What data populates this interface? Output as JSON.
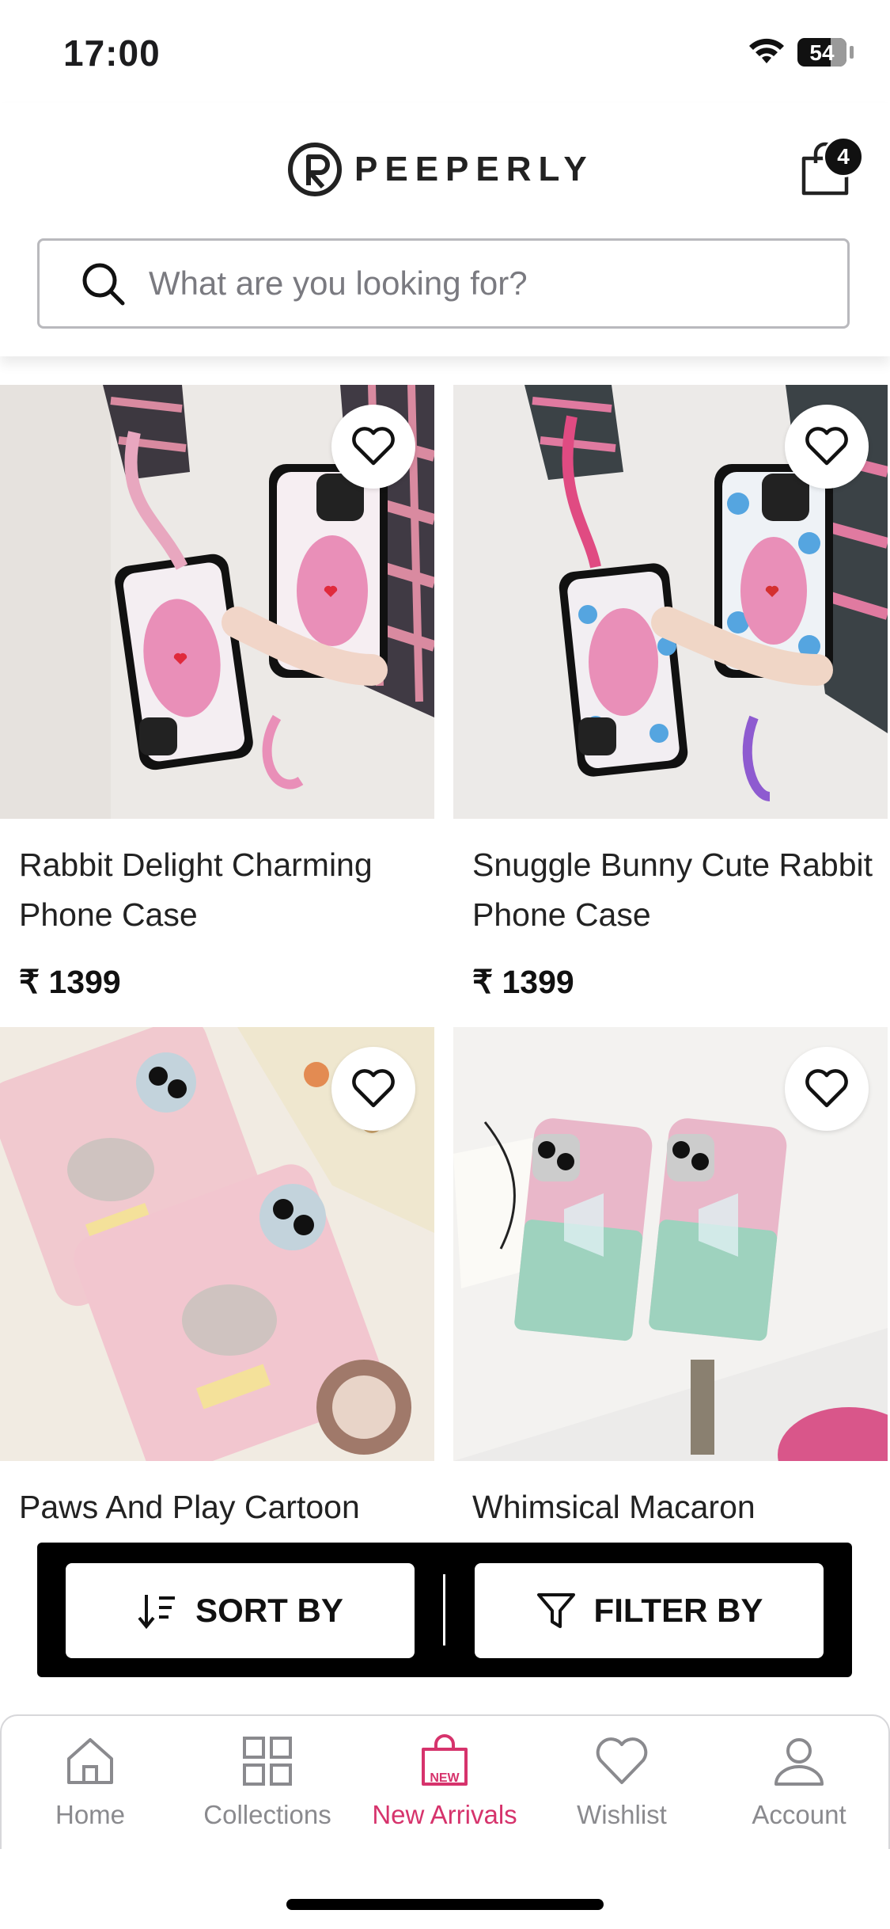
{
  "status_bar": {
    "time": "17:00",
    "battery": "54"
  },
  "header": {
    "brand": "PEEPERLY",
    "cart_count": "4",
    "search_placeholder": "What are you looking for?"
  },
  "products": [
    {
      "title": "Rabbit Delight Charming Phone Case",
      "price": "₹ 1399"
    },
    {
      "title": "Snuggle Bunny Cute Rabbit Phone Case",
      "price": "₹ 1399"
    },
    {
      "title": "Paws And Play Cartoon",
      "price": ""
    },
    {
      "title": "Whimsical Macaron",
      "price": ""
    }
  ],
  "actions": {
    "sort_label": "SORT BY",
    "filter_label": "FILTER BY"
  },
  "tabbar": {
    "items": [
      {
        "label": "Home",
        "icon": "home-icon"
      },
      {
        "label": "Collections",
        "icon": "grid-icon"
      },
      {
        "label": "New Arrivals",
        "icon": "shopping-bag-new-icon",
        "badge": "NEW"
      },
      {
        "label": "Wishlist",
        "icon": "heart-icon"
      },
      {
        "label": "Account",
        "icon": "person-icon"
      }
    ],
    "active": "New Arrivals"
  },
  "colors": {
    "accent": "#d6336c",
    "inactive": "#8a8a8e",
    "bar": "#000000"
  }
}
